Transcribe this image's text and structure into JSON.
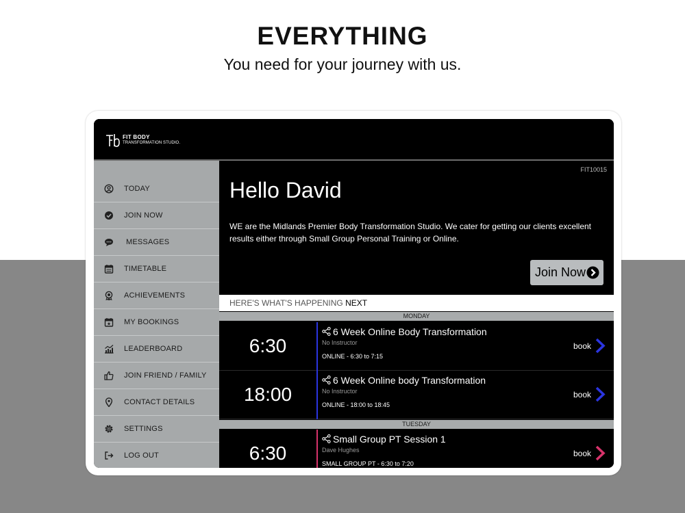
{
  "headline": "EVERYTHING",
  "subheadline": "You need for your journey with us.",
  "app": {
    "logo": {
      "line1": "FIT BODY",
      "line2": "TRANSFORMATION STUDIO."
    },
    "member_id": "FIT10015",
    "nav": [
      {
        "label": "TODAY",
        "icon": "user-circle-icon"
      },
      {
        "label": "JOIN NOW",
        "icon": "check-circle-icon"
      },
      {
        "label": "MESSAGES",
        "icon": "chat-bubble-icon"
      },
      {
        "label": "TIMETABLE",
        "icon": "calendar-icon"
      },
      {
        "label": "ACHIEVEMENTS",
        "icon": "award-icon"
      },
      {
        "label": "MY BOOKINGS",
        "icon": "calendar-star-icon"
      },
      {
        "label": "LEADERBOARD",
        "icon": "chart-icon"
      },
      {
        "label": "JOIN FRIEND / FAMILY",
        "icon": "thumbs-up-icon"
      },
      {
        "label": "CONTACT DETAILS",
        "icon": "map-pin-icon"
      },
      {
        "label": "SETTINGS",
        "icon": "gear-icon"
      },
      {
        "label": "LOG OUT",
        "icon": "logout-icon"
      }
    ],
    "greeting": "Hello David",
    "intro": "WE are the Midlands Premier Body Transformation Studio. We cater for getting our clients excellent results either through Small Group Personal Training or Online.",
    "join_button": "Join Now",
    "happening": {
      "prefix": "HERE'S WHAT'S HAPPENING",
      "suffix": "NEXT"
    },
    "days": [
      {
        "day": "MONDAY",
        "accent": "#2b35e0",
        "sessions": [
          {
            "time": "6:30",
            "title": "6 Week Online Body Transformation",
            "instructor": "No Instructor",
            "info": "ONLINE - 6:30 to 7:15",
            "book": "book"
          },
          {
            "time": "18:00",
            "title": "6 Week Online body Transformation",
            "instructor": "No Instructor",
            "info": "ONLINE - 18:00 to 18:45",
            "book": "book"
          }
        ]
      },
      {
        "day": "TUESDAY",
        "accent": "#d7336b",
        "sessions": [
          {
            "time": "6:30",
            "title": "Small Group PT Session 1",
            "instructor": "Dave Hughes",
            "info": "SMALL GROUP PT - 6:30 to 7:20",
            "book": "book"
          }
        ]
      }
    ]
  }
}
